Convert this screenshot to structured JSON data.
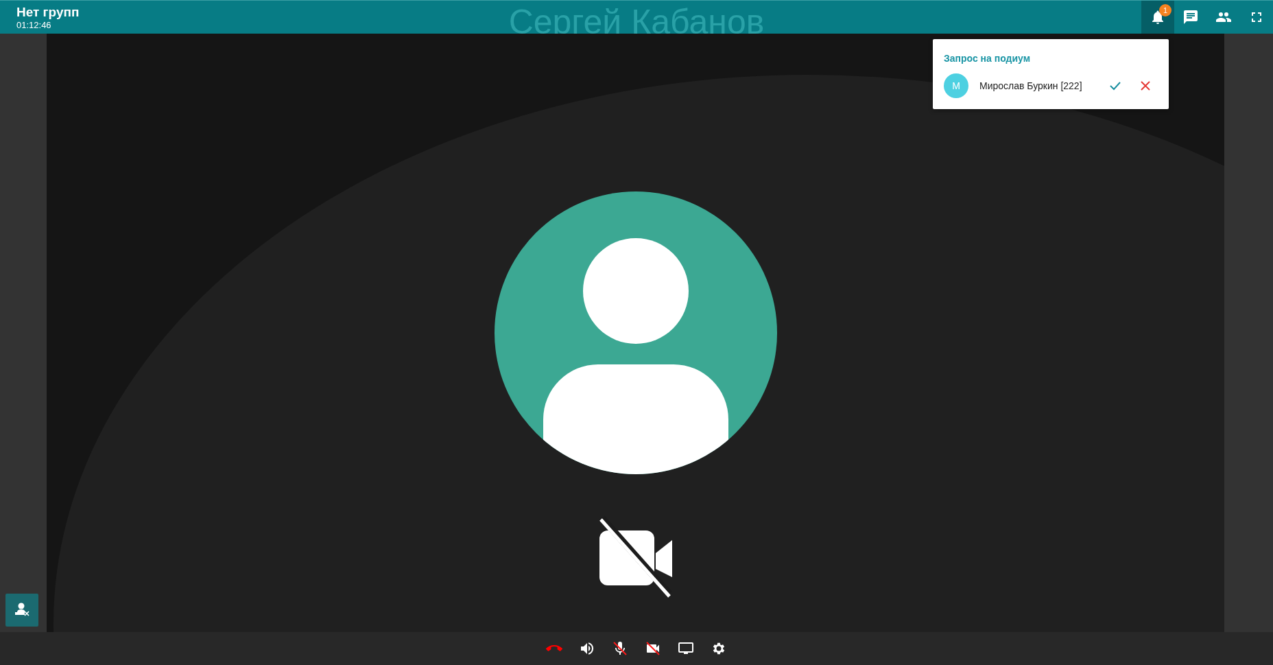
{
  "header": {
    "title": "Нет групп",
    "time": "01:12:46",
    "speaker": "Сергей Кабанов"
  },
  "header_buttons": [
    {
      "kind": "notifications",
      "selected": true,
      "badge": "1"
    },
    {
      "kind": "chat",
      "selected": false
    },
    {
      "kind": "participants",
      "selected": false
    },
    {
      "kind": "fullscreen",
      "selected": false
    }
  ],
  "popup": {
    "title": "Запрос на подиум",
    "requests": [
      {
        "initial": "М",
        "name": "Мирослав Буркин [222]"
      }
    ]
  },
  "toolbar": [
    {
      "kind": "hangup"
    },
    {
      "kind": "volume"
    },
    {
      "kind": "mic",
      "off": true
    },
    {
      "kind": "camera",
      "off": true
    },
    {
      "kind": "screen"
    },
    {
      "kind": "settings"
    }
  ],
  "camera_off": true
}
